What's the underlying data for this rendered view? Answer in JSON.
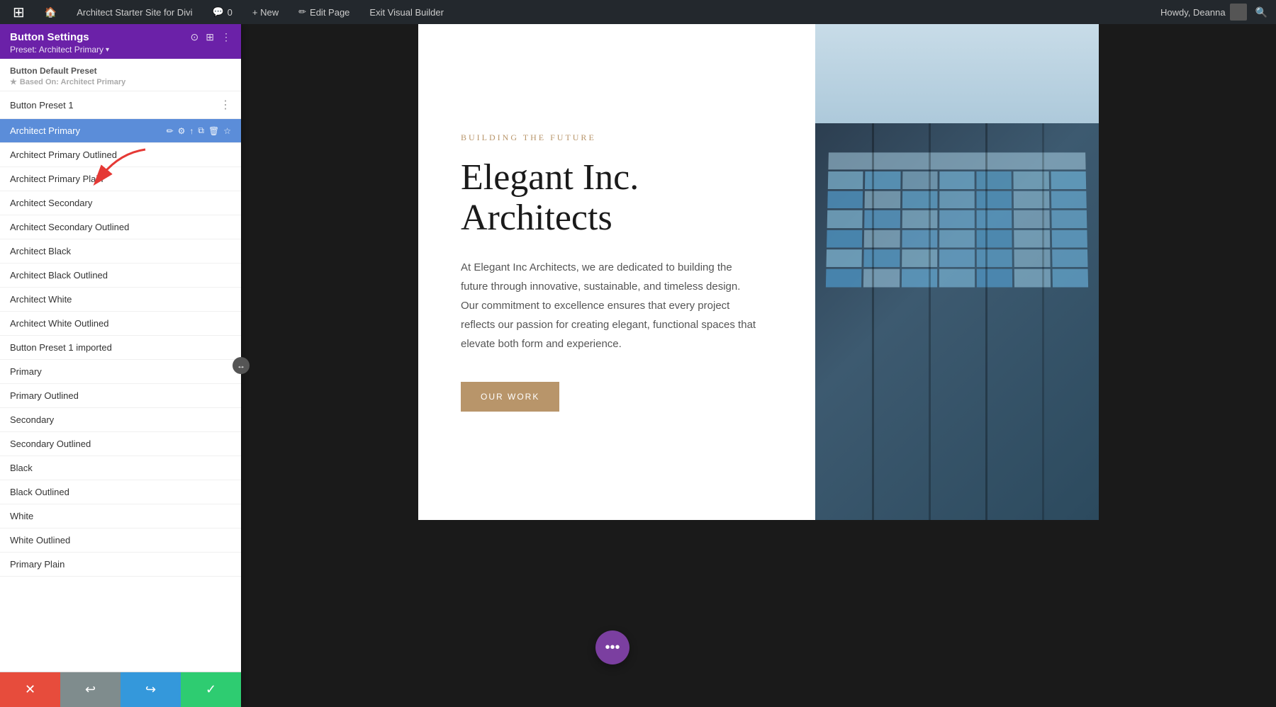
{
  "adminBar": {
    "wpLogo": "⊞",
    "siteName": "Architect Starter Site for Divi",
    "commentCount": "0",
    "newLabel": "+ New",
    "editPageLabel": "Edit Page",
    "exitBuilderLabel": "Exit Visual Builder",
    "howdyLabel": "Howdy, Deanna",
    "searchIcon": "🔍"
  },
  "panel": {
    "title": "Button Settings",
    "preset": "Preset: Architect Primary",
    "presetArrow": "▾",
    "defaultPreset": {
      "header": "Button Default Preset",
      "basedOn": "Based On: Architect Primary"
    },
    "buttonPreset1": "Button Preset 1",
    "presetItems": [
      {
        "label": "Architect Primary",
        "active": true
      },
      {
        "label": "Architect Primary Outlined",
        "active": false
      },
      {
        "label": "Architect Primary Plain",
        "active": false
      },
      {
        "label": "Architect Secondary",
        "active": false
      },
      {
        "label": "Architect Secondary Outlined",
        "active": false
      },
      {
        "label": "Architect Black",
        "active": false
      },
      {
        "label": "Architect Black Outlined",
        "active": false
      },
      {
        "label": "Architect White",
        "active": false
      },
      {
        "label": "Architect White Outlined",
        "active": false
      },
      {
        "label": "Button Preset 1 imported",
        "active": false
      },
      {
        "label": "Primary",
        "active": false
      },
      {
        "label": "Primary Outlined",
        "active": false
      },
      {
        "label": "Secondary",
        "active": false
      },
      {
        "label": "Secondary Outlined",
        "active": false
      },
      {
        "label": "Black",
        "active": false
      },
      {
        "label": "Black Outlined",
        "active": false
      },
      {
        "label": "White",
        "active": false
      },
      {
        "label": "White Outlined",
        "active": false
      },
      {
        "label": "Primary Plain",
        "active": false
      }
    ],
    "footer": {
      "cancelIcon": "✕",
      "undoIcon": "↩",
      "redoIcon": "↪",
      "saveIcon": "✓"
    }
  },
  "hero": {
    "eyebrow": "BUILDING THE FUTURE",
    "title": "Elegant Inc. Architects",
    "body": "At Elegant Inc Architects, we are dedicated to building the future through innovative, sustainable, and timeless design. Our commitment to excellence ensures that every project reflects our passion for creating elegant, functional spaces that elevate both form and experience.",
    "buttonLabel": "OUR WORK"
  },
  "colors": {
    "panelHeaderBg": "#6b21a8",
    "activeItemBg": "#5b8dd9",
    "cancelBtn": "#e74c3c",
    "undoBtn": "#7f8c8d",
    "redoBtn": "#3498db",
    "saveBtn": "#2ecc71",
    "heroAccent": "#b8956a",
    "floatingBtn": "#7b3fa0"
  }
}
